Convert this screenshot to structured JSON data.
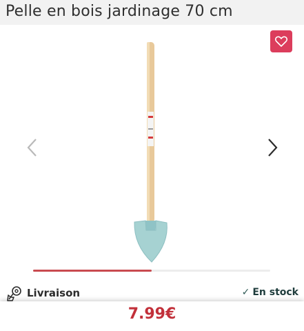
{
  "product": {
    "title": "Pelle en bois jardinage 70 cm",
    "price": "7.99€"
  },
  "icons": {
    "favorite": "heart-icon",
    "previous": "chevron-left-icon",
    "next": "chevron-right-icon",
    "delivery": "delivery-location-icon",
    "stock": "check-icon"
  },
  "gallery": {
    "position_fraction": 0.5
  },
  "delivery": {
    "label": "Livraison",
    "stock_label": "En stock"
  },
  "colors": {
    "favorite_button": "#dc3d5c",
    "progress": "#c94a4f",
    "price": "#c2303a"
  }
}
